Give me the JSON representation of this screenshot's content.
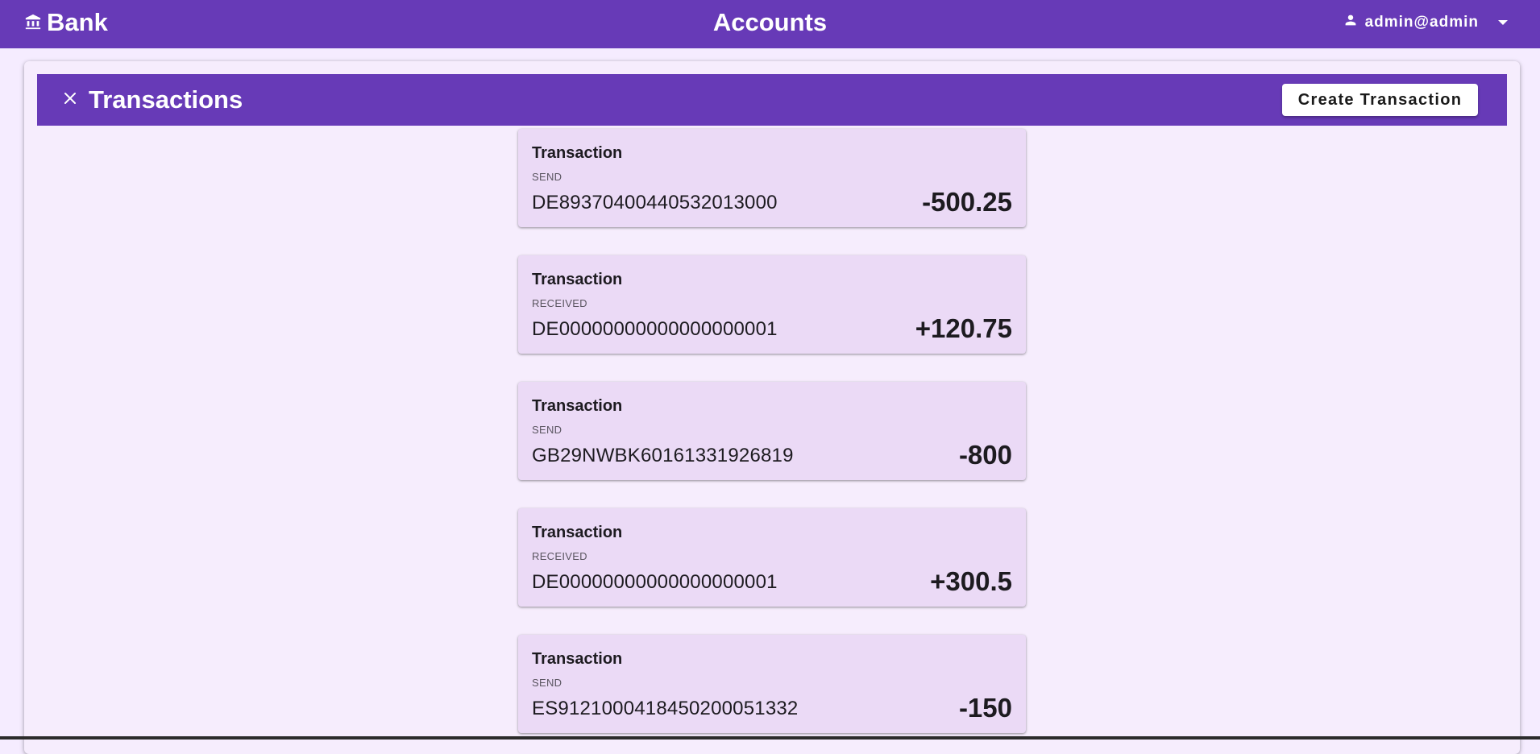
{
  "topbar": {
    "brand": "Bank",
    "title": "Accounts",
    "user_email": "admin@admin",
    "brand_icon": "bank-icon",
    "user_icon": "person-icon",
    "menu_icon": "caret-down-icon"
  },
  "panel": {
    "title": "Transactions",
    "close_icon": "close-icon",
    "create_button": "Create Transaction"
  },
  "transactions": [
    {
      "title": "Transaction",
      "type": "SEND",
      "iban": "DE89370400440532013000",
      "amount": "-500.25"
    },
    {
      "title": "Transaction",
      "type": "RECEIVED",
      "iban": "DE00000000000000000001",
      "amount": "+120.75"
    },
    {
      "title": "Transaction",
      "type": "SEND",
      "iban": "GB29NWBK60161331926819",
      "amount": "-800"
    },
    {
      "title": "Transaction",
      "type": "RECEIVED",
      "iban": "DE00000000000000000001",
      "amount": "+300.5"
    },
    {
      "title": "Transaction",
      "type": "SEND",
      "iban": "ES9121000418450200051332",
      "amount": "-150"
    }
  ],
  "colors": {
    "primary": "#673ab7",
    "background": "#f5ecff",
    "card": "#ebdaf6"
  }
}
